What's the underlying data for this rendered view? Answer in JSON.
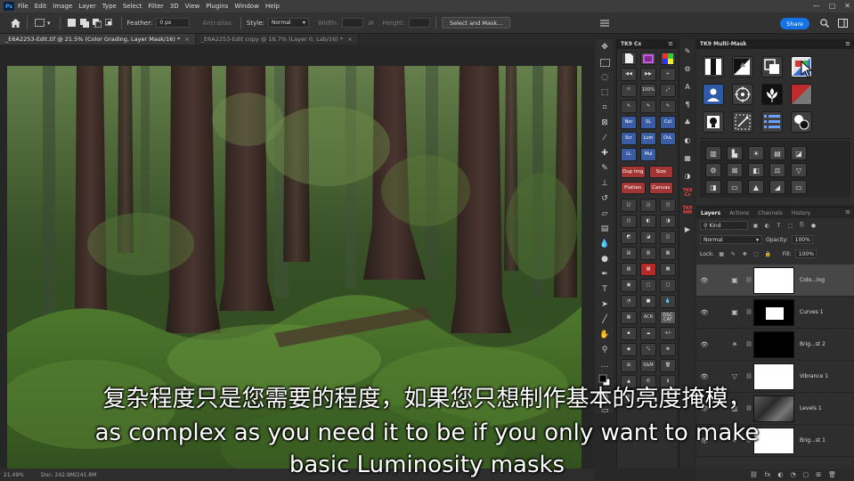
{
  "menubar": {
    "app_icon": "Ps",
    "items": [
      "File",
      "Edit",
      "Image",
      "Layer",
      "Type",
      "Select",
      "Filter",
      "3D",
      "View",
      "Plugins",
      "Window",
      "Help"
    ],
    "window_controls": [
      "—",
      "□",
      "✕"
    ]
  },
  "options": {
    "feather_label": "Feather:",
    "feather_value": "0 px",
    "antialias_label": "Anti-alias",
    "style_label": "Style:",
    "style_value": "Normal",
    "width_label": "Width:",
    "height_label": "Height:",
    "select_mask_button": "Select and Mask...",
    "share_button": "Share"
  },
  "tabs": [
    {
      "label": "_E6A2253-Edit.tif @ 21.5% (Color Grading, Layer Mask/16) *",
      "active": true
    },
    {
      "label": "_E6A2253-Edit copy @ 16.7% (Layer 0, Lab/16) *",
      "active": false
    }
  ],
  "status": {
    "zoom": "21.49%",
    "doc": "Doc: 242.9M/241.8M"
  },
  "tk9cx": {
    "title": "TK9 Cx",
    "buttons": [
      {
        "label": "",
        "style": ""
      },
      {
        "label": "",
        "style": ""
      },
      {
        "label": "",
        "style": ""
      },
      {
        "label": "◀◀",
        "style": ""
      },
      {
        "label": "▶▶",
        "style": ""
      },
      {
        "label": "+",
        "style": ""
      },
      {
        "label": "⤧",
        "style": ""
      },
      {
        "label": "100%",
        "style": ""
      },
      {
        "label": "⤢",
        "style": ""
      },
      {
        "label": "✎",
        "style": ""
      },
      {
        "label": "✎",
        "style": ""
      },
      {
        "label": "✎",
        "style": ""
      },
      {
        "label": "Nor",
        "style": "blue"
      },
      {
        "label": "SL",
        "style": "blue"
      },
      {
        "label": "Col",
        "style": "blue"
      },
      {
        "label": "Scr",
        "style": "blue"
      },
      {
        "label": "Lum",
        "style": "blue"
      },
      {
        "label": "OvL",
        "style": "blue"
      },
      {
        "label": "LL",
        "style": "blue"
      },
      {
        "label": "Mul",
        "style": "blue"
      }
    ],
    "wide_buttons": [
      [
        "Dup Img",
        "Size"
      ],
      [
        "Flatten",
        "Canvas"
      ]
    ],
    "lower_buttons": [
      "◱",
      "◲",
      "◳",
      "◰",
      "◧",
      "◨",
      "◩",
      "◪",
      "◫",
      "▤",
      "▥",
      "▦",
      "▧",
      "▨",
      "▩",
      "▣",
      "▢",
      "□",
      "◔",
      "■",
      "💧",
      "▦",
      "ACR",
      "D&C CAF",
      "▪",
      "☁",
      "+/-",
      "◆",
      "⤡",
      "✥",
      "⊞",
      "S&M",
      "🗑",
      "▲",
      "©",
      "⬇",
      "TK9",
      "◉",
      "≋"
    ]
  },
  "multimask": {
    "title": "TK9 Multi-Mask",
    "big_buttons": [
      "▮▯",
      "◭",
      "⧉",
      "◩",
      "👤",
      "⊕",
      "🌷",
      "◢",
      "◐",
      "⬚",
      "☰",
      "⚫"
    ],
    "small_buttons": [
      "▥",
      "▙",
      "☀",
      "▤",
      "◪",
      "⚙",
      "⊠",
      "◧",
      "⚖",
      "▽",
      "◨",
      "▭",
      "▲",
      "◢",
      "▭"
    ]
  },
  "layers": {
    "tabs": [
      "Layers",
      "Actions",
      "Channels",
      "History"
    ],
    "kind_label": "Kind",
    "blend_mode": "Normal",
    "opacity_label": "Opacity:",
    "opacity_value": "100%",
    "lock_label": "Lock:",
    "fill_label": "Fill:",
    "fill_value": "100%",
    "list": [
      {
        "name": "Colo...ing",
        "icon": "▣",
        "mask": "white",
        "active": true
      },
      {
        "name": "Curves 1",
        "icon": "▣",
        "mask": "curves",
        "active": false
      },
      {
        "name": "Brig...st 2",
        "icon": "☀",
        "mask": "black",
        "active": false
      },
      {
        "name": "Vibrance 1",
        "icon": "▽",
        "mask": "white",
        "active": false
      },
      {
        "name": "Levels 1",
        "icon": "▥",
        "mask": "photo",
        "active": false
      },
      {
        "name": "Brig...st 1",
        "icon": "☀",
        "mask": "white",
        "active": false
      }
    ],
    "footer_icons": [
      "⛓",
      "fx",
      "◐",
      "◔",
      "▢",
      "⊞",
      "🗑"
    ]
  },
  "subtitles": {
    "zh": "复杂程度只是您需要的程度，如果您只想制作基本的亮度掩模，",
    "en_line1": "as complex as you need it to be if you only want to make",
    "en_line2": "basic Luminosity masks"
  }
}
